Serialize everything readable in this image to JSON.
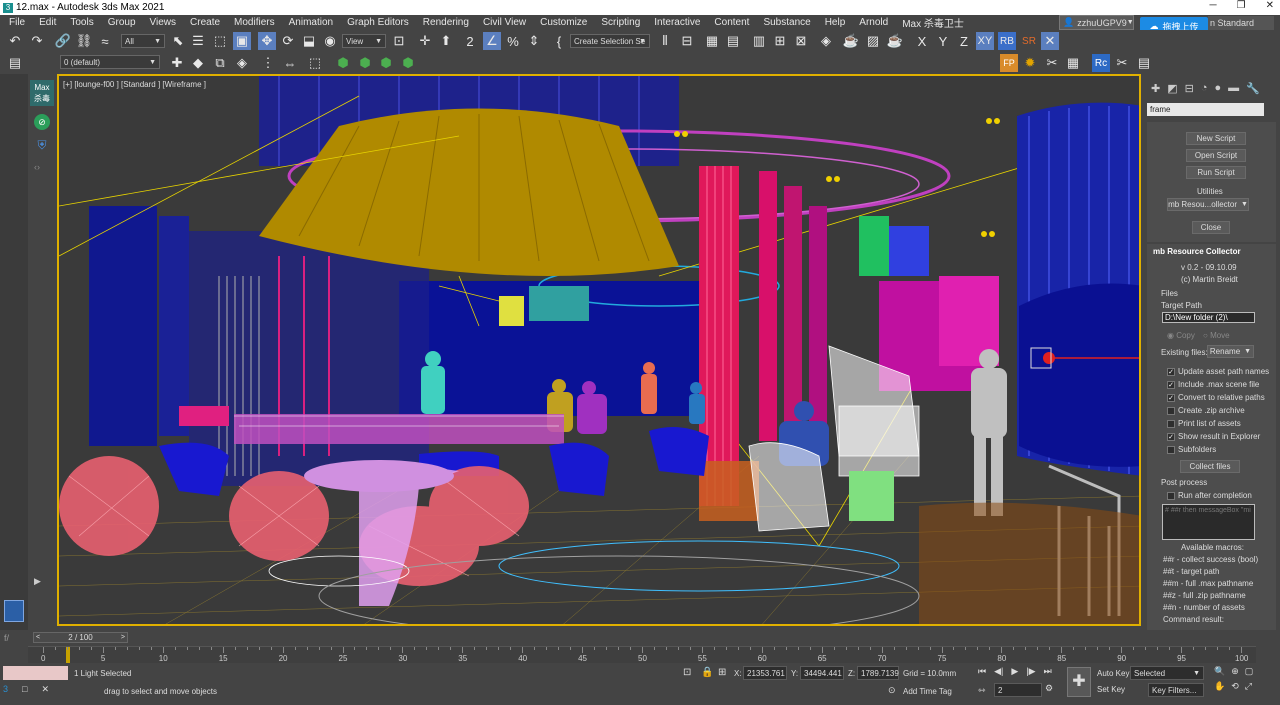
{
  "window": {
    "title": "12.max - Autodesk 3ds Max 2021",
    "icon": "3ds-max-icon",
    "controls": [
      "minimize-icon",
      "restore-icon",
      "close-icon"
    ]
  },
  "menu": [
    "File",
    "Edit",
    "Tools",
    "Group",
    "Views",
    "Create",
    "Modifiers",
    "Animation",
    "Graph Editors",
    "Rendering",
    "Civil View",
    "Customize",
    "Scripting",
    "Interactive",
    "Content",
    "Substance",
    "Help",
    "Arnold",
    "Max 杀毒卫士"
  ],
  "user": {
    "name": "zzhuUGPV9",
    "upload_label": "拖拽上传",
    "workspace": "n Standard"
  },
  "toolbar": {
    "filter": "All",
    "view": "View",
    "selection_set": "Create Selection Se",
    "layer": "0 (default)",
    "axes": [
      "X",
      "Y",
      "Z",
      "XY",
      "RB",
      "SR"
    ]
  },
  "viewport": {
    "label": "[+] [lounge-f00 ] [Standard ] [Wireframe ]"
  },
  "leftbar": {
    "max_label": "Max",
    "max_sub": "杀毒"
  },
  "panel": {
    "search": "frame",
    "buttons": {
      "new_script": "New Script",
      "open_script": "Open Script",
      "run_script": "Run Script",
      "close": "Close",
      "collect": "Collect files"
    },
    "utilities_label": "Utilities",
    "utilities_value": "mb Resou...ollector",
    "rollout_title": "mb Resource Collector",
    "version": "v 0.2 - 09.10.09",
    "author": "(c) Martin Breidt",
    "files_label": "Files",
    "target_path_label": "Target Path",
    "target_path": "D:\\New folder (2)\\",
    "copy": "Copy",
    "move": "Move",
    "existing_label": "Existing files:",
    "existing_value": "Rename",
    "options": [
      {
        "label": "Update asset path names",
        "checked": "✓"
      },
      {
        "label": "Include .max scene file",
        "checked": "✓"
      },
      {
        "label": "Convert to relative paths",
        "checked": "✓"
      },
      {
        "label": "Create .zip archive",
        "checked": ""
      },
      {
        "label": "Print list of assets",
        "checked": ""
      },
      {
        "label": "Show result in Explorer",
        "checked": "✓"
      },
      {
        "label": "Subfolders",
        "checked": ""
      }
    ],
    "post_label": "Post process",
    "run_after": "Run after completion",
    "script_placeholder": "# ##r then messageBox \"mi",
    "macros_title": "Available macros:",
    "macros": [
      "##r - collect success (bool)",
      "##t - target path",
      "##m - full .max pathname",
      "##z - full .zip pathname",
      "##n - number of assets"
    ],
    "command_result": "Command result:"
  },
  "timeline": {
    "slider": "2 / 100",
    "ticks": [
      "0",
      "5",
      "10",
      "15",
      "20",
      "25",
      "30",
      "35",
      "40",
      "45",
      "50",
      "55",
      "60",
      "65",
      "70",
      "75",
      "80",
      "85",
      "90",
      "95",
      "100"
    ]
  },
  "status": {
    "selected": "1 Light Selected",
    "prompt": "drag to select and move objects",
    "x": "21353.761",
    "y": "34494.441",
    "z": "1789.7139",
    "grid": "Grid = 10.0mm",
    "add_time_tag": "Add Time Tag",
    "auto_key": "Auto Key",
    "set_key": "Set Key",
    "key_mode": "Selected",
    "key_filters": "Key Filters...",
    "frame": "2"
  }
}
